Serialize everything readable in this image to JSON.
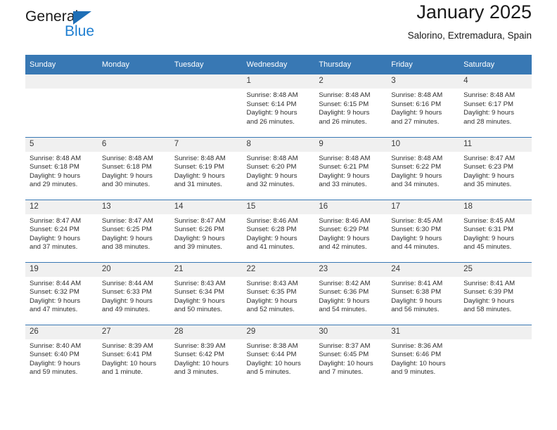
{
  "brand": {
    "name_top": "General",
    "name_bottom": "Blue",
    "accent_color": "#1f7fd1",
    "triangle_color": "#1f6fb6"
  },
  "header": {
    "title": "January 2025",
    "subtitle": "Salorino, Extremadura, Spain"
  },
  "calendar": {
    "header_bg": "#3878b4",
    "daynum_bg": "#f0f0f0",
    "weekday_headers": [
      "Sunday",
      "Monday",
      "Tuesday",
      "Wednesday",
      "Thursday",
      "Friday",
      "Saturday"
    ],
    "weeks": [
      [
        {
          "day": "",
          "blank": true
        },
        {
          "day": "",
          "blank": true
        },
        {
          "day": "",
          "blank": true
        },
        {
          "day": "1",
          "sunrise": "Sunrise: 8:48 AM",
          "sunset": "Sunset: 6:14 PM",
          "daylight_line1": "Daylight: 9 hours",
          "daylight_line2": "and 26 minutes."
        },
        {
          "day": "2",
          "sunrise": "Sunrise: 8:48 AM",
          "sunset": "Sunset: 6:15 PM",
          "daylight_line1": "Daylight: 9 hours",
          "daylight_line2": "and 26 minutes."
        },
        {
          "day": "3",
          "sunrise": "Sunrise: 8:48 AM",
          "sunset": "Sunset: 6:16 PM",
          "daylight_line1": "Daylight: 9 hours",
          "daylight_line2": "and 27 minutes."
        },
        {
          "day": "4",
          "sunrise": "Sunrise: 8:48 AM",
          "sunset": "Sunset: 6:17 PM",
          "daylight_line1": "Daylight: 9 hours",
          "daylight_line2": "and 28 minutes."
        }
      ],
      [
        {
          "day": "5",
          "sunrise": "Sunrise: 8:48 AM",
          "sunset": "Sunset: 6:18 PM",
          "daylight_line1": "Daylight: 9 hours",
          "daylight_line2": "and 29 minutes."
        },
        {
          "day": "6",
          "sunrise": "Sunrise: 8:48 AM",
          "sunset": "Sunset: 6:18 PM",
          "daylight_line1": "Daylight: 9 hours",
          "daylight_line2": "and 30 minutes."
        },
        {
          "day": "7",
          "sunrise": "Sunrise: 8:48 AM",
          "sunset": "Sunset: 6:19 PM",
          "daylight_line1": "Daylight: 9 hours",
          "daylight_line2": "and 31 minutes."
        },
        {
          "day": "8",
          "sunrise": "Sunrise: 8:48 AM",
          "sunset": "Sunset: 6:20 PM",
          "daylight_line1": "Daylight: 9 hours",
          "daylight_line2": "and 32 minutes."
        },
        {
          "day": "9",
          "sunrise": "Sunrise: 8:48 AM",
          "sunset": "Sunset: 6:21 PM",
          "daylight_line1": "Daylight: 9 hours",
          "daylight_line2": "and 33 minutes."
        },
        {
          "day": "10",
          "sunrise": "Sunrise: 8:48 AM",
          "sunset": "Sunset: 6:22 PM",
          "daylight_line1": "Daylight: 9 hours",
          "daylight_line2": "and 34 minutes."
        },
        {
          "day": "11",
          "sunrise": "Sunrise: 8:47 AM",
          "sunset": "Sunset: 6:23 PM",
          "daylight_line1": "Daylight: 9 hours",
          "daylight_line2": "and 35 minutes."
        }
      ],
      [
        {
          "day": "12",
          "sunrise": "Sunrise: 8:47 AM",
          "sunset": "Sunset: 6:24 PM",
          "daylight_line1": "Daylight: 9 hours",
          "daylight_line2": "and 37 minutes."
        },
        {
          "day": "13",
          "sunrise": "Sunrise: 8:47 AM",
          "sunset": "Sunset: 6:25 PM",
          "daylight_line1": "Daylight: 9 hours",
          "daylight_line2": "and 38 minutes."
        },
        {
          "day": "14",
          "sunrise": "Sunrise: 8:47 AM",
          "sunset": "Sunset: 6:26 PM",
          "daylight_line1": "Daylight: 9 hours",
          "daylight_line2": "and 39 minutes."
        },
        {
          "day": "15",
          "sunrise": "Sunrise: 8:46 AM",
          "sunset": "Sunset: 6:28 PM",
          "daylight_line1": "Daylight: 9 hours",
          "daylight_line2": "and 41 minutes."
        },
        {
          "day": "16",
          "sunrise": "Sunrise: 8:46 AM",
          "sunset": "Sunset: 6:29 PM",
          "daylight_line1": "Daylight: 9 hours",
          "daylight_line2": "and 42 minutes."
        },
        {
          "day": "17",
          "sunrise": "Sunrise: 8:45 AM",
          "sunset": "Sunset: 6:30 PM",
          "daylight_line1": "Daylight: 9 hours",
          "daylight_line2": "and 44 minutes."
        },
        {
          "day": "18",
          "sunrise": "Sunrise: 8:45 AM",
          "sunset": "Sunset: 6:31 PM",
          "daylight_line1": "Daylight: 9 hours",
          "daylight_line2": "and 45 minutes."
        }
      ],
      [
        {
          "day": "19",
          "sunrise": "Sunrise: 8:44 AM",
          "sunset": "Sunset: 6:32 PM",
          "daylight_line1": "Daylight: 9 hours",
          "daylight_line2": "and 47 minutes."
        },
        {
          "day": "20",
          "sunrise": "Sunrise: 8:44 AM",
          "sunset": "Sunset: 6:33 PM",
          "daylight_line1": "Daylight: 9 hours",
          "daylight_line2": "and 49 minutes."
        },
        {
          "day": "21",
          "sunrise": "Sunrise: 8:43 AM",
          "sunset": "Sunset: 6:34 PM",
          "daylight_line1": "Daylight: 9 hours",
          "daylight_line2": "and 50 minutes."
        },
        {
          "day": "22",
          "sunrise": "Sunrise: 8:43 AM",
          "sunset": "Sunset: 6:35 PM",
          "daylight_line1": "Daylight: 9 hours",
          "daylight_line2": "and 52 minutes."
        },
        {
          "day": "23",
          "sunrise": "Sunrise: 8:42 AM",
          "sunset": "Sunset: 6:36 PM",
          "daylight_line1": "Daylight: 9 hours",
          "daylight_line2": "and 54 minutes."
        },
        {
          "day": "24",
          "sunrise": "Sunrise: 8:41 AM",
          "sunset": "Sunset: 6:38 PM",
          "daylight_line1": "Daylight: 9 hours",
          "daylight_line2": "and 56 minutes."
        },
        {
          "day": "25",
          "sunrise": "Sunrise: 8:41 AM",
          "sunset": "Sunset: 6:39 PM",
          "daylight_line1": "Daylight: 9 hours",
          "daylight_line2": "and 58 minutes."
        }
      ],
      [
        {
          "day": "26",
          "sunrise": "Sunrise: 8:40 AM",
          "sunset": "Sunset: 6:40 PM",
          "daylight_line1": "Daylight: 9 hours",
          "daylight_line2": "and 59 minutes."
        },
        {
          "day": "27",
          "sunrise": "Sunrise: 8:39 AM",
          "sunset": "Sunset: 6:41 PM",
          "daylight_line1": "Daylight: 10 hours",
          "daylight_line2": "and 1 minute."
        },
        {
          "day": "28",
          "sunrise": "Sunrise: 8:39 AM",
          "sunset": "Sunset: 6:42 PM",
          "daylight_line1": "Daylight: 10 hours",
          "daylight_line2": "and 3 minutes."
        },
        {
          "day": "29",
          "sunrise": "Sunrise: 8:38 AM",
          "sunset": "Sunset: 6:44 PM",
          "daylight_line1": "Daylight: 10 hours",
          "daylight_line2": "and 5 minutes."
        },
        {
          "day": "30",
          "sunrise": "Sunrise: 8:37 AM",
          "sunset": "Sunset: 6:45 PM",
          "daylight_line1": "Daylight: 10 hours",
          "daylight_line2": "and 7 minutes."
        },
        {
          "day": "31",
          "sunrise": "Sunrise: 8:36 AM",
          "sunset": "Sunset: 6:46 PM",
          "daylight_line1": "Daylight: 10 hours",
          "daylight_line2": "and 9 minutes."
        },
        {
          "day": "",
          "blank": true
        }
      ]
    ]
  }
}
